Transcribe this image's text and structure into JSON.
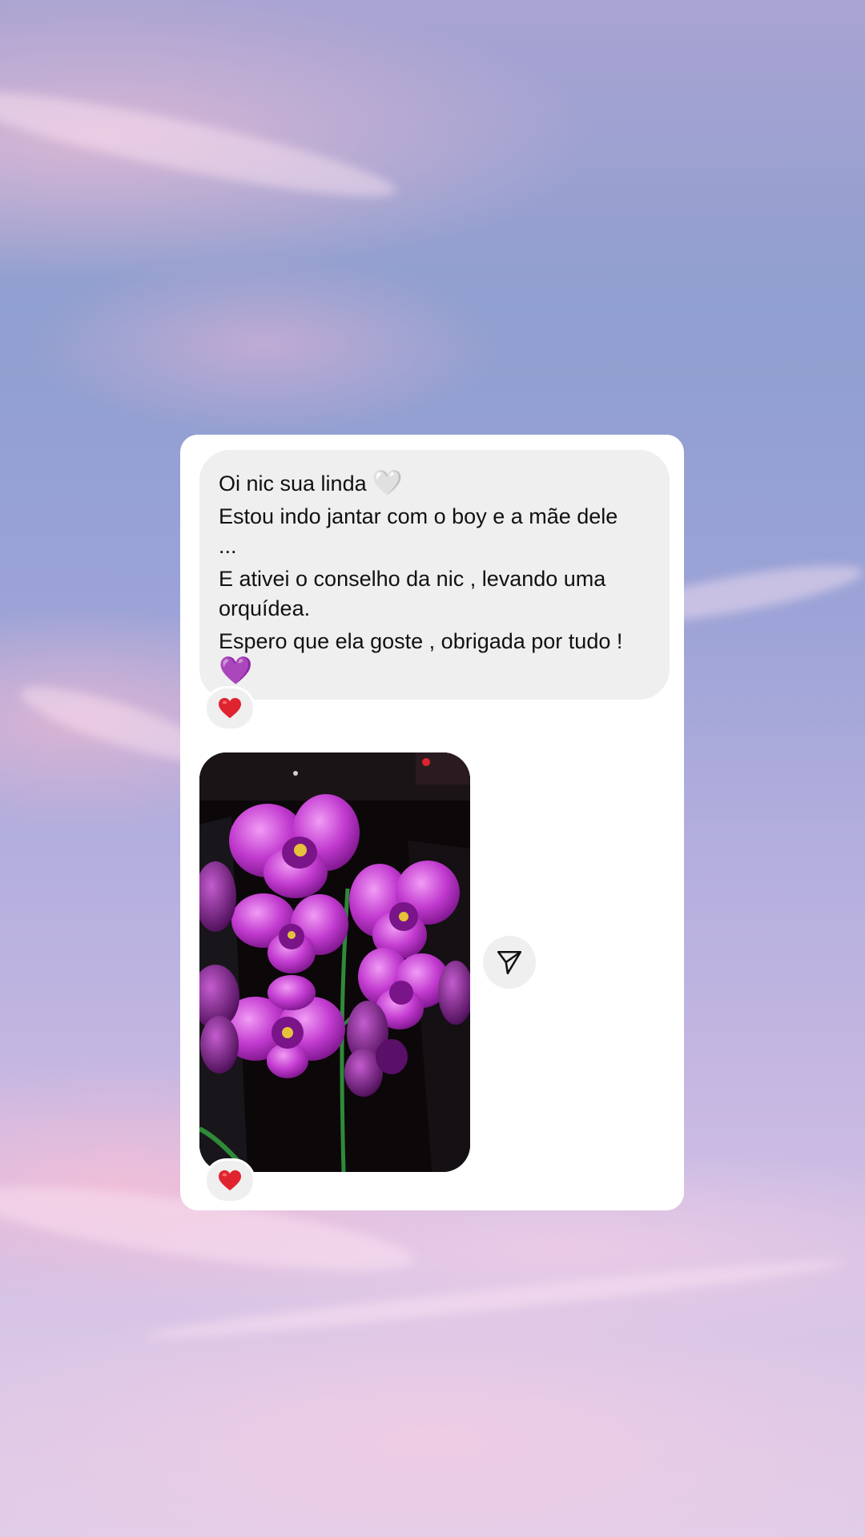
{
  "message": {
    "lines": [
      "Oi nic sua linda",
      "Estou indo jantar com o boy e a mãe dele ...",
      "E ativei o conselho da nic , levando uma orquídea.",
      "Espero que ela goste , obrigada por tudo !"
    ],
    "line1_emoji": "🤍",
    "line4_emoji": "💜",
    "reaction_icon": "red-heart-icon"
  },
  "photo": {
    "description_icon": "orchid-photo",
    "reaction_icon": "red-heart-icon"
  },
  "share": {
    "icon": "paper-plane-icon"
  },
  "colors": {
    "card": "#ffffff",
    "bubble": "#efefef",
    "text": "#111111",
    "reaction_heart": "#e0242f",
    "orchid": "#c23bd0"
  }
}
